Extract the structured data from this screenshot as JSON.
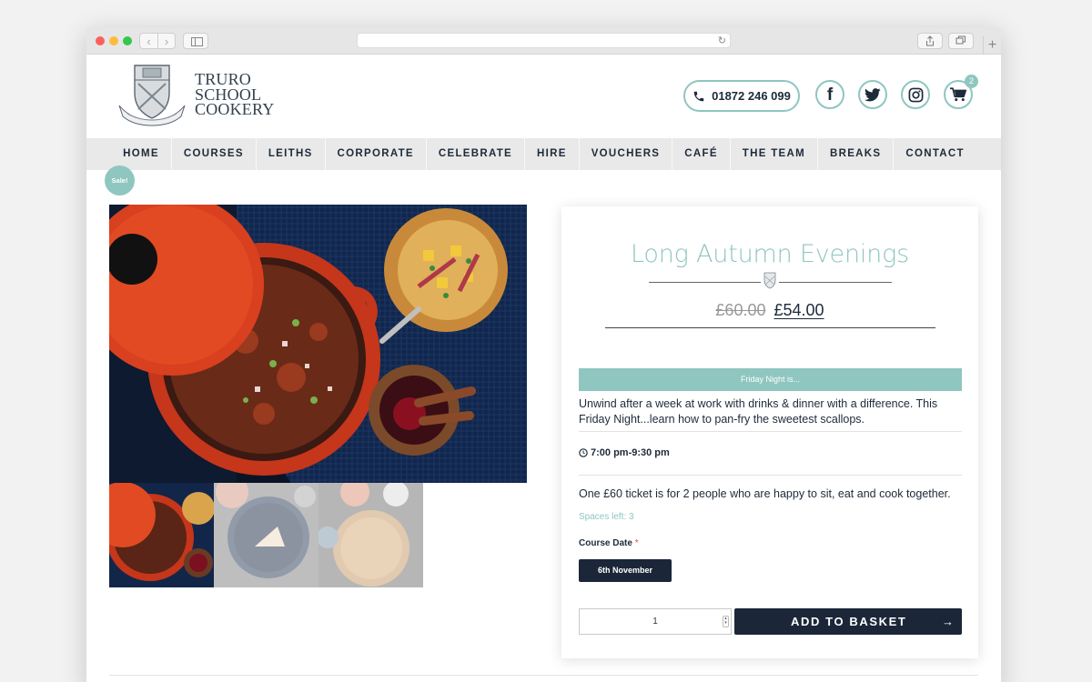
{
  "site": {
    "logo_lines": [
      "TRURO",
      "SCHOOL",
      "COOKERY"
    ],
    "phone": "01872 246 099",
    "cart_count": "2"
  },
  "nav": {
    "items": [
      "HOME",
      "COURSES",
      "LEITHS",
      "CORPORATE",
      "CELEBRATE",
      "HIRE",
      "VOUCHERS",
      "CAFÉ",
      "THE TEAM",
      "BREAKS",
      "CONTACT"
    ]
  },
  "product": {
    "sale_badge": "Sale!",
    "title": "Long Autumn Evenings",
    "old_price": "£60.00",
    "new_price": "£54.00",
    "notice": "Friday Night is...",
    "description": "Unwind after a week at work with drinks & dinner with a difference. This Friday Night...learn how to pan-fry the sweetest scallops.",
    "time": "7:00 pm-9:30 pm",
    "ticket_info": "One £60 ticket is for 2 people who are happy to sit, eat and cook together.",
    "spaces_left": "Spaces left: 3",
    "date_label": "Course Date",
    "date_required": "*",
    "date_option": "6th November",
    "quantity": "1",
    "add_to_basket": "ADD TO BASKET"
  },
  "colors": {
    "accent": "#8fc6c0",
    "navy": "#1b2738",
    "nav_bg": "#e9e9e9"
  },
  "icons": {
    "phone": "phone-icon",
    "facebook": "facebook-icon",
    "twitter": "twitter-icon",
    "instagram": "instagram-icon",
    "cart": "cart-icon",
    "clock": "clock-icon",
    "arrow": "arrow-right-icon"
  }
}
